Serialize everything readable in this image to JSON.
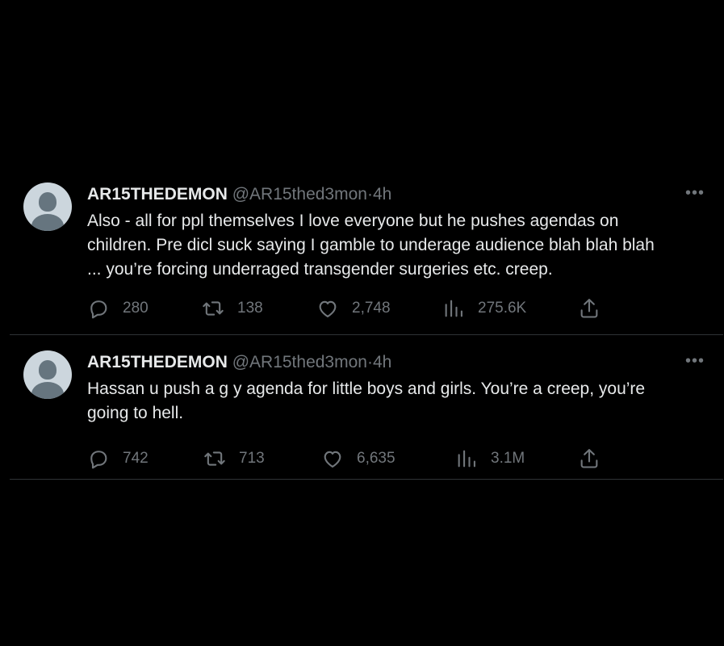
{
  "tweets": [
    {
      "name": "AR15THEDEMON",
      "handle": "@AR15thed3mon",
      "separator": "·",
      "time": "4h",
      "more_label": "•••",
      "text_lines": [
        "Also - all for ppl themselves I love everyone but he pushes agendas on",
        "children. Pre dicl  suck saying I gamble to underage audience blah blah blah",
        "... you’re forcing underraged transgender surgeries etc. creep."
      ],
      "replies": "280",
      "retweets": "138",
      "likes": "2,748",
      "views": "275.6K"
    },
    {
      "name": "AR15THEDEMON",
      "handle": "@AR15thed3mon",
      "separator": "·",
      "time": "4h",
      "more_label": "•••",
      "text_lines": [
        "Hassan u push a g  y agenda for little boys and girls. You’re a creep, you’re",
        "going to hell."
      ],
      "replies": "742",
      "retweets": "713",
      "likes": "6,635",
      "views": "3.1M"
    }
  ],
  "icons": {
    "reply": "reply-icon",
    "retweet": "retweet-icon",
    "like": "like-icon",
    "views": "views-icon",
    "share": "share-icon",
    "more": "more-icon"
  },
  "colors": {
    "background": "#000000",
    "text_primary": "#e7e9ea",
    "text_secondary": "#71767b",
    "divider": "#2f3336",
    "avatar_bg": "#ccd6dd",
    "avatar_fg": "#66757f"
  }
}
